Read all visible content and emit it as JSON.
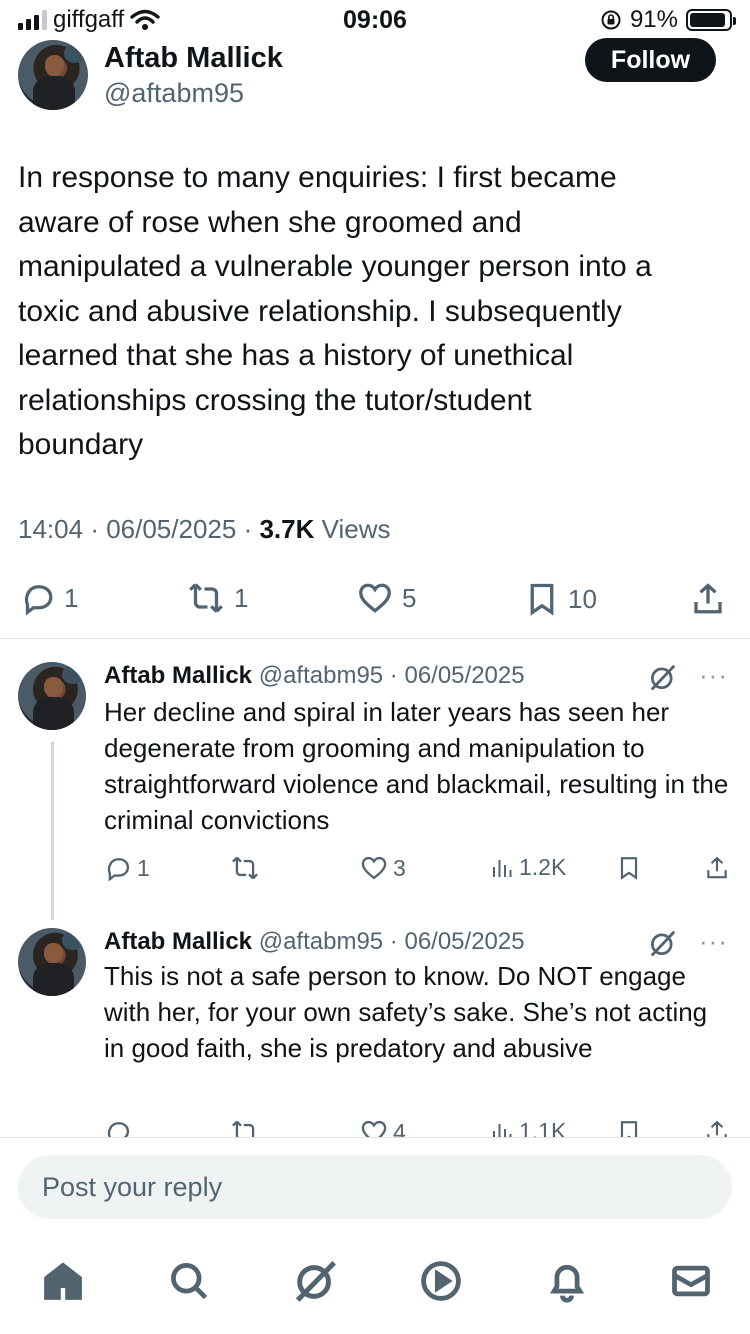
{
  "status_bar": {
    "carrier": "giffgaff",
    "time": "09:06",
    "battery": "91%",
    "battery_level": 0.91
  },
  "main_tweet": {
    "author_name": "Aftab Mallick",
    "handle": "@aftabm95",
    "follow_label": "Follow",
    "text": "In response to many enquiries: I first became\naware of rose when she groomed and\nmanipulated a vulnerable younger person into a\ntoxic and abusive relationship. I subsequently\nlearned that she has a history of unethical\nrelationships crossing the tutor/student\nboundary",
    "time": "14:04",
    "date": "06/05/2025",
    "views_count": "3.7K",
    "views_label": "Views",
    "replies": "1",
    "reposts": "1",
    "likes": "5",
    "bookmarks": "10"
  },
  "replies": [
    {
      "author_name": "Aftab Mallick",
      "handle": "@aftabm95",
      "date": "06/05/2025",
      "text": "Her decline and spiral in later years has seen her degenerate from grooming and manipulation to straightforward violence and blackmail, resulting in the criminal convictions",
      "replies": "1",
      "reposts": "",
      "likes": "3",
      "views": "1.2K"
    },
    {
      "author_name": "Aftab Mallick",
      "handle": "@aftabm95",
      "date": "06/05/2025",
      "text": "This is not a safe person to know. Do NOT engage with her, for your own safety’s sake. She’s not acting in good faith, she is predatory and abusive",
      "replies": "",
      "reposts": "",
      "likes": "4",
      "views": "1.1K"
    }
  ],
  "reply_bar": {
    "placeholder": "Post your reply"
  },
  "more_label": "···",
  "tabs": [
    "home-icon",
    "search-icon",
    "grok-icon",
    "video-icon",
    "notifications-icon",
    "messages-icon"
  ]
}
